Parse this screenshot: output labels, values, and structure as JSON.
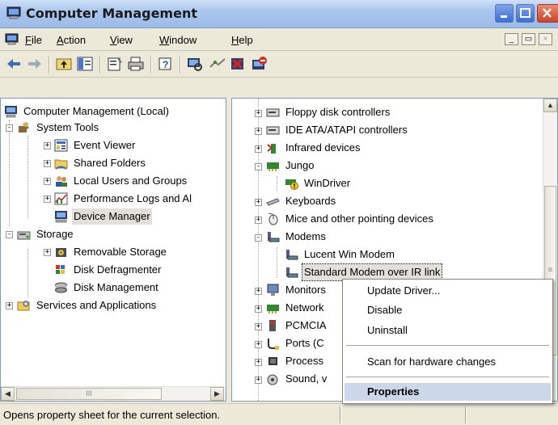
{
  "window": {
    "title": "Computer Management"
  },
  "menu": {
    "items": [
      {
        "name": "menu-file",
        "label": "File",
        "u": "F",
        "rest": "ile"
      },
      {
        "name": "menu-action",
        "label": "Action",
        "u": "A",
        "rest": "ction"
      },
      {
        "name": "menu-view",
        "label": "View",
        "u": "V",
        "rest": "iew"
      },
      {
        "name": "menu-window",
        "label": "Window",
        "u": "W",
        "rest": "indow"
      },
      {
        "name": "menu-help",
        "label": "Help",
        "u": "H",
        "rest": "elp"
      }
    ],
    "mdi_minimize": "_",
    "mdi_restore": "▭",
    "mdi_close": "×"
  },
  "tree": {
    "root": "Computer Management (Local)",
    "system_tools": "System Tools",
    "event_viewer": "Event Viewer",
    "shared_folders": "Shared Folders",
    "local_users": "Local Users and Groups",
    "perf_logs": "Performance Logs and Al",
    "device_manager": "Device Manager",
    "storage": "Storage",
    "removable_storage": "Removable Storage",
    "disk_defrag": "Disk Defragmenter",
    "disk_mgmt": "Disk Management",
    "services_apps": "Services and Applications"
  },
  "devices": {
    "floppy": "Floppy disk controllers",
    "ide": "IDE ATA/ATAPI controllers",
    "infrared": "Infrared devices",
    "jungo": "Jungo",
    "windriver": "WinDriver",
    "keyboards": "Keyboards",
    "mice": "Mice and other pointing devices",
    "modems": "Modems",
    "lucent": "Lucent Win Modem",
    "standard_modem": "Standard Modem over IR link",
    "monitors": "Monitors",
    "network": "Network",
    "pcmcia": "PCMCIA",
    "ports": "Ports (C",
    "processors": "Process",
    "sound": "Sound, v"
  },
  "context_menu": {
    "update_driver": "Update Driver...",
    "disable": "Disable",
    "uninstall": "Uninstall",
    "scan": "Scan for hardware changes",
    "properties": "Properties"
  },
  "statusbar": {
    "text": "Opens property sheet for the current selection."
  },
  "scroll": {
    "left_h_thumb": "III",
    "right_v_grip": "≡"
  }
}
